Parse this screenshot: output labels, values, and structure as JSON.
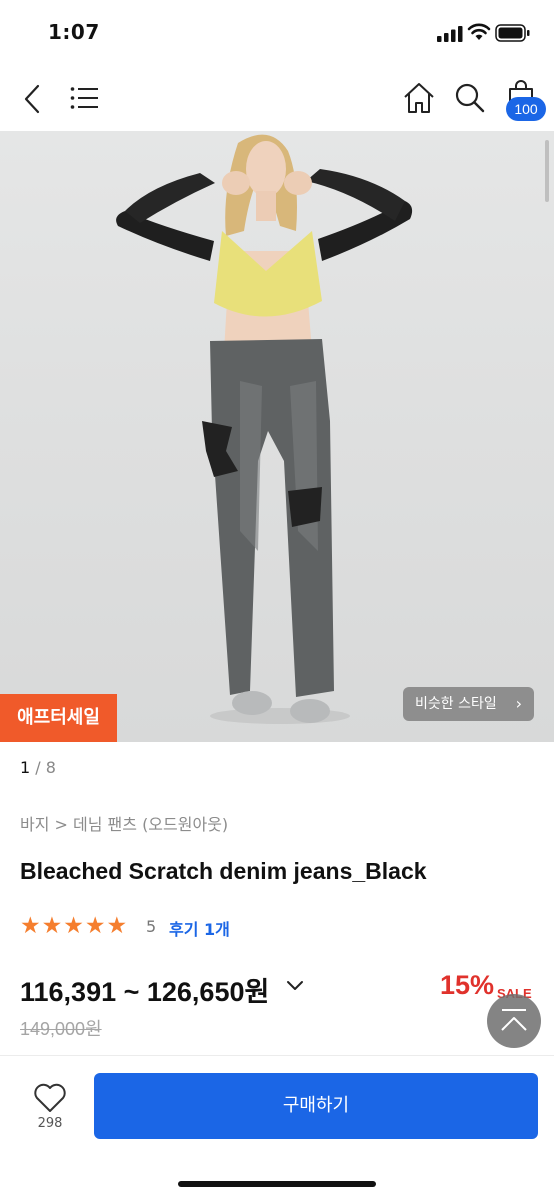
{
  "status_bar": {
    "time": "1:07"
  },
  "nav": {
    "cart_count": "100",
    "icons": [
      "back-icon",
      "menu-list-icon",
      "home-icon",
      "search-icon",
      "shopping-bag-icon"
    ]
  },
  "gallery": {
    "current": "1",
    "total": "/ 8",
    "sale_tag": "애프터세일",
    "similar_style": "비슷한 스타일",
    "similar_chevron": "›"
  },
  "product": {
    "breadcrumb": "바지 > 데님 팬츠 (오드원아웃)",
    "title": "Bleached Scratch denim jeans_Black",
    "rating_stars": 5,
    "rating_value": "5",
    "review_text": "후기 1개",
    "price_range": "116,391 ~ 126,650원",
    "discount_percent": "15%",
    "discount_label": "SALE",
    "original_price": "149,000원"
  },
  "bottom_bar": {
    "like_count": "298",
    "buy_label": "구매하기"
  },
  "colors": {
    "accent_blue": "#1b66e6",
    "sale_orange": "#f05a2a",
    "discount_red": "#e0322c",
    "star_orange": "#f57e2e"
  }
}
